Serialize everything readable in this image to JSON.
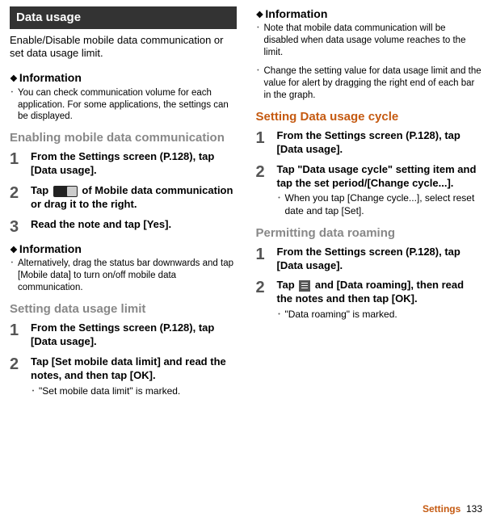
{
  "left": {
    "banner": "Data usage",
    "intro": "Enable/Disable mobile data communication or set data usage limit.",
    "info1_head": "Information",
    "info1_b1": "You can check communication volume for each application. For some applications, the settings can be displayed.",
    "sub1": "Enabling mobile data communication",
    "s1_1": "From the Settings screen (P.128), tap [Data usage].",
    "s1_2a": "Tap ",
    "s1_2b": " of Mobile data communication or drag it to the right.",
    "s1_3": "Read the note and tap [Yes].",
    "info2_head": "Information",
    "info2_b1": "Alternatively, drag the status bar downwards and tap [Mobile data] to turn on/off mobile data communication.",
    "sub2": "Setting data usage limit",
    "s2_1": "From the Settings screen (P.128), tap [Data usage].",
    "s2_2": "Tap [Set mobile data limit] and read the notes, and then tap [OK].",
    "s2_2sub": "\"Set mobile data limit\" is marked."
  },
  "right": {
    "info3_head": "Information",
    "info3_b1": "Note that mobile data communication will be disabled when data usage volume reaches to the limit.",
    "info3_b2": "Change the setting value for data usage limit and the value for alert by dragging the right end of each bar in the graph.",
    "sub3": "Setting Data usage cycle",
    "s3_1": "From the Settings screen (P.128), tap [Data usage].",
    "s3_2": "Tap \"Data usage cycle\" setting item and tap the set period/[Change cycle...].",
    "s3_2sub": "When you tap [Change cycle...], select reset date and tap [Set].",
    "sub4": "Permitting data roaming",
    "s4_1": "From the Settings screen (P.128), tap [Data usage].",
    "s4_2a": "Tap ",
    "s4_2b": " and [Data roaming], then read the notes and then tap [OK].",
    "s4_2sub": "\"Data roaming\" is marked."
  },
  "footer_label": "Settings",
  "footer_page": "133"
}
